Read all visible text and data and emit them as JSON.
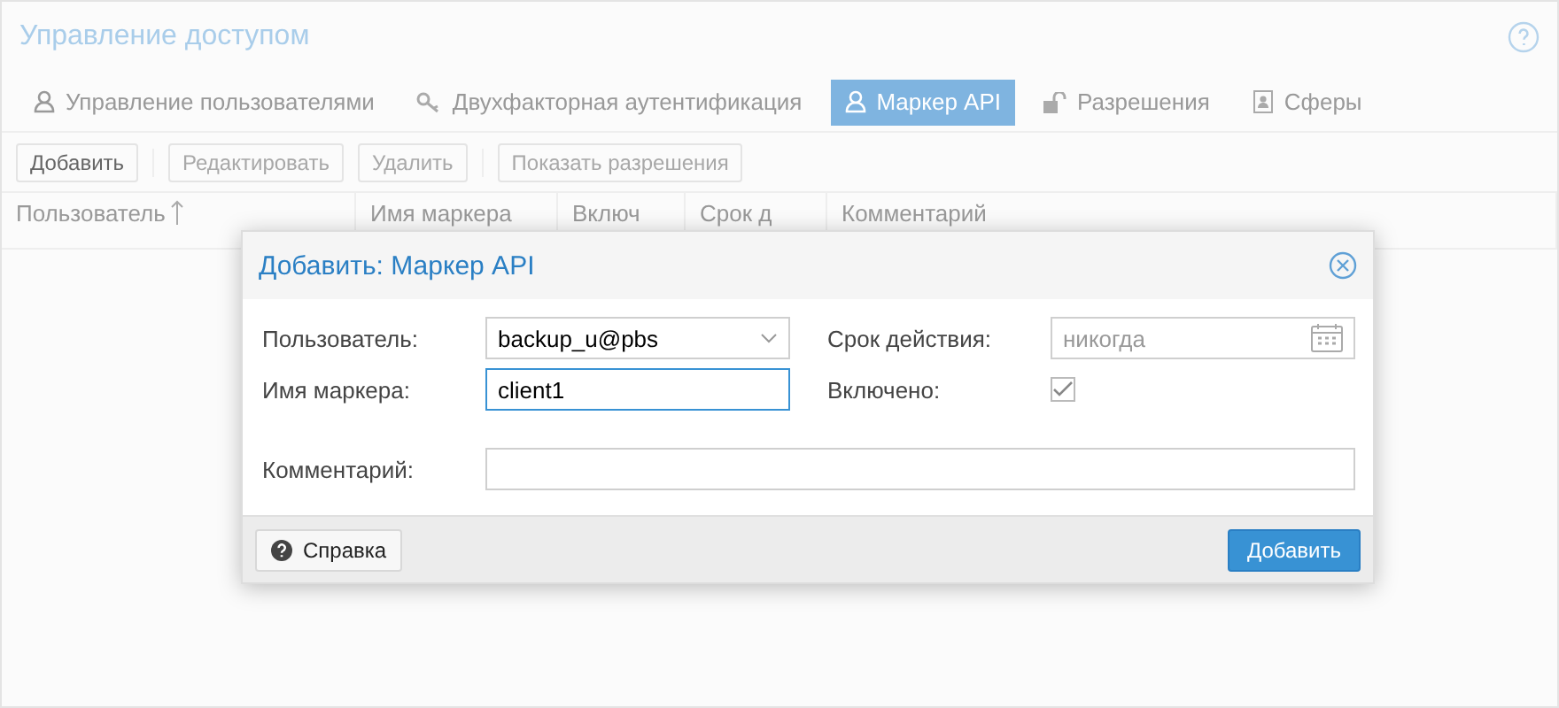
{
  "panel": {
    "title": "Управление доступом"
  },
  "tabs": [
    {
      "label": "Управление пользователями",
      "kind": "user",
      "selected": false
    },
    {
      "label": "Двухфакторная аутентификация",
      "kind": "key",
      "selected": false
    },
    {
      "label": "Маркер API",
      "kind": "user",
      "selected": true
    },
    {
      "label": "Разрешения",
      "kind": "lock",
      "selected": false
    },
    {
      "label": "Сферы",
      "kind": "book",
      "selected": false
    }
  ],
  "toolbar": [
    {
      "label": "Добавить",
      "disabled": false
    },
    {
      "label": "Редактировать",
      "disabled": true
    },
    {
      "label": "Удалить",
      "disabled": true
    },
    {
      "label": "Показать разрешения",
      "disabled": true
    }
  ],
  "table": {
    "columns": [
      {
        "label": "Пользователь",
        "sorted": true
      },
      {
        "label": "Имя маркера",
        "sorted": false
      },
      {
        "label": "Включ",
        "sorted": false
      },
      {
        "label": "Срок д",
        "sorted": false
      },
      {
        "label": "Комментарий",
        "sorted": false
      }
    ]
  },
  "dialog": {
    "title": "Добавить: Маркер API",
    "user": {
      "label": "Пользователь:",
      "value": "backup_u@pbs"
    },
    "expire": {
      "label": "Срок действия:",
      "placeholder": "никогда"
    },
    "token": {
      "label": "Имя маркера:",
      "value": "client1"
    },
    "enabled": {
      "label": "Включено:",
      "checked": true
    },
    "comment": {
      "label": "Комментарий:"
    },
    "help_button": "Справка",
    "submit_button": "Добавить"
  }
}
